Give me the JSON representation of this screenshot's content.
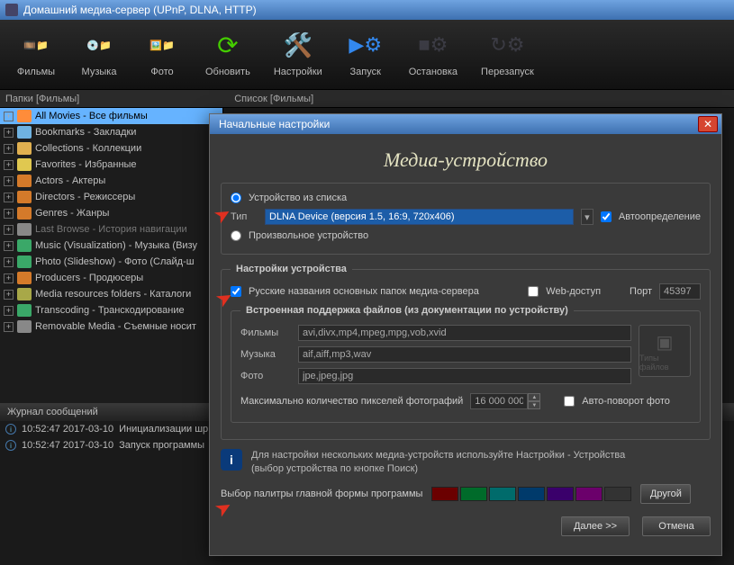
{
  "window": {
    "title": "Домашний медиа-сервер (UPnP, DLNA, HTTP)"
  },
  "toolbar": {
    "films": "Фильмы",
    "music": "Музыка",
    "photo": "Фото",
    "refresh": "Обновить",
    "settings": "Настройки",
    "start": "Запуск",
    "stop": "Остановка",
    "restart": "Перезапуск"
  },
  "pathbar": {
    "folders": "Папки [Фильмы]",
    "list": "Список [Фильмы]"
  },
  "tree": {
    "items": [
      {
        "label": "All Movies - Все фильмы",
        "color": "#ff8c3a",
        "selected": true
      },
      {
        "label": "Bookmarks - Закладки",
        "color": "#6fb2e0"
      },
      {
        "label": "Collections - Коллекции",
        "color": "#e0b050"
      },
      {
        "label": "Favorites - Избранные",
        "color": "#e0c850"
      },
      {
        "label": "Actors - Актеры",
        "color": "#d47a2a"
      },
      {
        "label": "Directors - Режиссеры",
        "color": "#d47a2a"
      },
      {
        "label": "Genres - Жанры",
        "color": "#d47a2a"
      },
      {
        "label": "Last Browse - История навигации",
        "color": "#888",
        "dim": true
      },
      {
        "label": "Music (Visualization) - Музыка (Визу",
        "color": "#3aa868"
      },
      {
        "label": "Photo (Slideshow) - Фото (Слайд-ш",
        "color": "#3aa868"
      },
      {
        "label": "Producers - Продюсеры",
        "color": "#d47a2a"
      },
      {
        "label": "Media resources folders - Каталоги",
        "color": "#a8a848"
      },
      {
        "label": "Transcoding - Транскодирование",
        "color": "#3aa868"
      },
      {
        "label": "Removable Media - Съемные носит",
        "color": "#888"
      }
    ]
  },
  "log": {
    "title": "Журнал сообщений",
    "rows": [
      {
        "time": "10:52:47 2017-03-10",
        "msg": "Инициализации шр"
      },
      {
        "time": "10:52:47 2017-03-10",
        "msg": "Запуск программы"
      }
    ]
  },
  "dialog": {
    "title": "Начальные настройки",
    "hero": "Медиа-устройство",
    "radio_list": "Устройство из списка",
    "type_label": "Тип",
    "type_value": "DLNA Device (версия 1.5, 16:9, 720x406)",
    "autodetect": "Автоопределение",
    "radio_custom": "Произвольное устройство",
    "device_settings": "Настройки устройства",
    "rus_folders": "Русские названия основных папок медиа-сервера",
    "web_access": "Web-доступ",
    "port_label": "Порт",
    "port_value": "45397",
    "builtin": "Встроенная поддержка файлов (из документации по устройству)",
    "films_label": "Фильмы",
    "films_ext": "avi,divx,mp4,mpeg,mpg,vob,xvid",
    "music_label": "Музыка",
    "music_ext": "aif,aiff,mp3,wav",
    "photo_label": "Фото",
    "photo_ext": "jpe,jpeg,jpg",
    "filetypes_caption": "Типы файлов",
    "maxpx_label": "Максимально количество пикселей фотографий",
    "maxpx_value": "16 000 000",
    "autorotate": "Авто-поворот фото",
    "info1": "Для настройки нескольких медиа-устройств используйте Настройки - Устройства",
    "info2": "(выбор устройства по кнопке Поиск)",
    "palette_label": "Выбор палитры главной формы программы",
    "palette": [
      "#6b0000",
      "#006b2a",
      "#006b6b",
      "#003a6b",
      "#3a006b",
      "#6b006b",
      "#333333"
    ],
    "other": "Другой",
    "next": "Далее >>",
    "cancel": "Отмена"
  }
}
